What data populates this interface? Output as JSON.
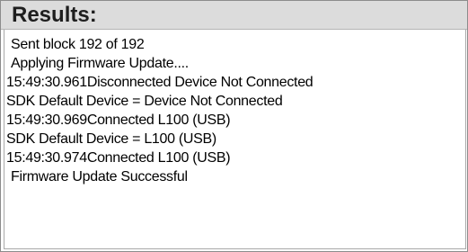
{
  "panel": {
    "title": "Results:"
  },
  "log": [
    {
      "text": "Sent block 192 of 192",
      "indent": true
    },
    {
      "text": "Applying Firmware Update....",
      "indent": true
    },
    {
      "text": "15:49:30.961Disconnected Device Not Connected",
      "indent": false
    },
    {
      "text": "SDK Default Device =  Device Not Connected",
      "indent": false
    },
    {
      "text": "15:49:30.969Connected L100 (USB)",
      "indent": false
    },
    {
      "text": "SDK Default Device =  L100 (USB)",
      "indent": false
    },
    {
      "text": "15:49:30.974Connected L100 (USB)",
      "indent": false
    },
    {
      "text": "Firmware Update Successful",
      "indent": true
    }
  ]
}
